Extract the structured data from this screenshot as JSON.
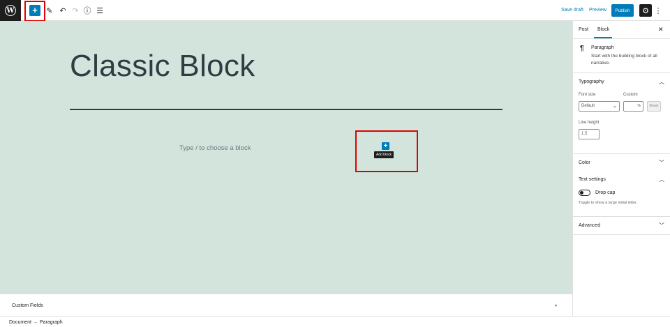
{
  "header": {
    "save_draft": "Save draft",
    "preview": "Preview",
    "publish": "Publish"
  },
  "editor": {
    "title": "Classic Block",
    "placeholder": "Type / to choose a block",
    "tooltip": "Add block"
  },
  "sidebar": {
    "tabs": [
      "Post",
      "Block"
    ],
    "block_card": {
      "title": "Paragraph",
      "description": "Start with the building block of all narrative."
    },
    "typography": {
      "title": "Typography",
      "font_size_label": "Font size",
      "custom_label": "Custom",
      "font_size_value": "Default",
      "custom_unit": "%",
      "reset_label": "Reset",
      "line_height_label": "Line height",
      "line_height_value": "1.5"
    },
    "color": {
      "title": "Color"
    },
    "text_settings": {
      "title": "Text settings",
      "drop_cap_label": "Drop cap",
      "drop_cap_help": "Toggle to show a large initial letter."
    },
    "advanced": {
      "title": "Advanced"
    }
  },
  "metabox": {
    "title": "Custom Fields"
  },
  "breadcrumb": {
    "items": [
      "Document",
      "Paragraph"
    ],
    "separator": "→"
  },
  "colors": {
    "accent": "#007cba",
    "canvas": "#d2e4dc",
    "highlight": "#e00000"
  }
}
